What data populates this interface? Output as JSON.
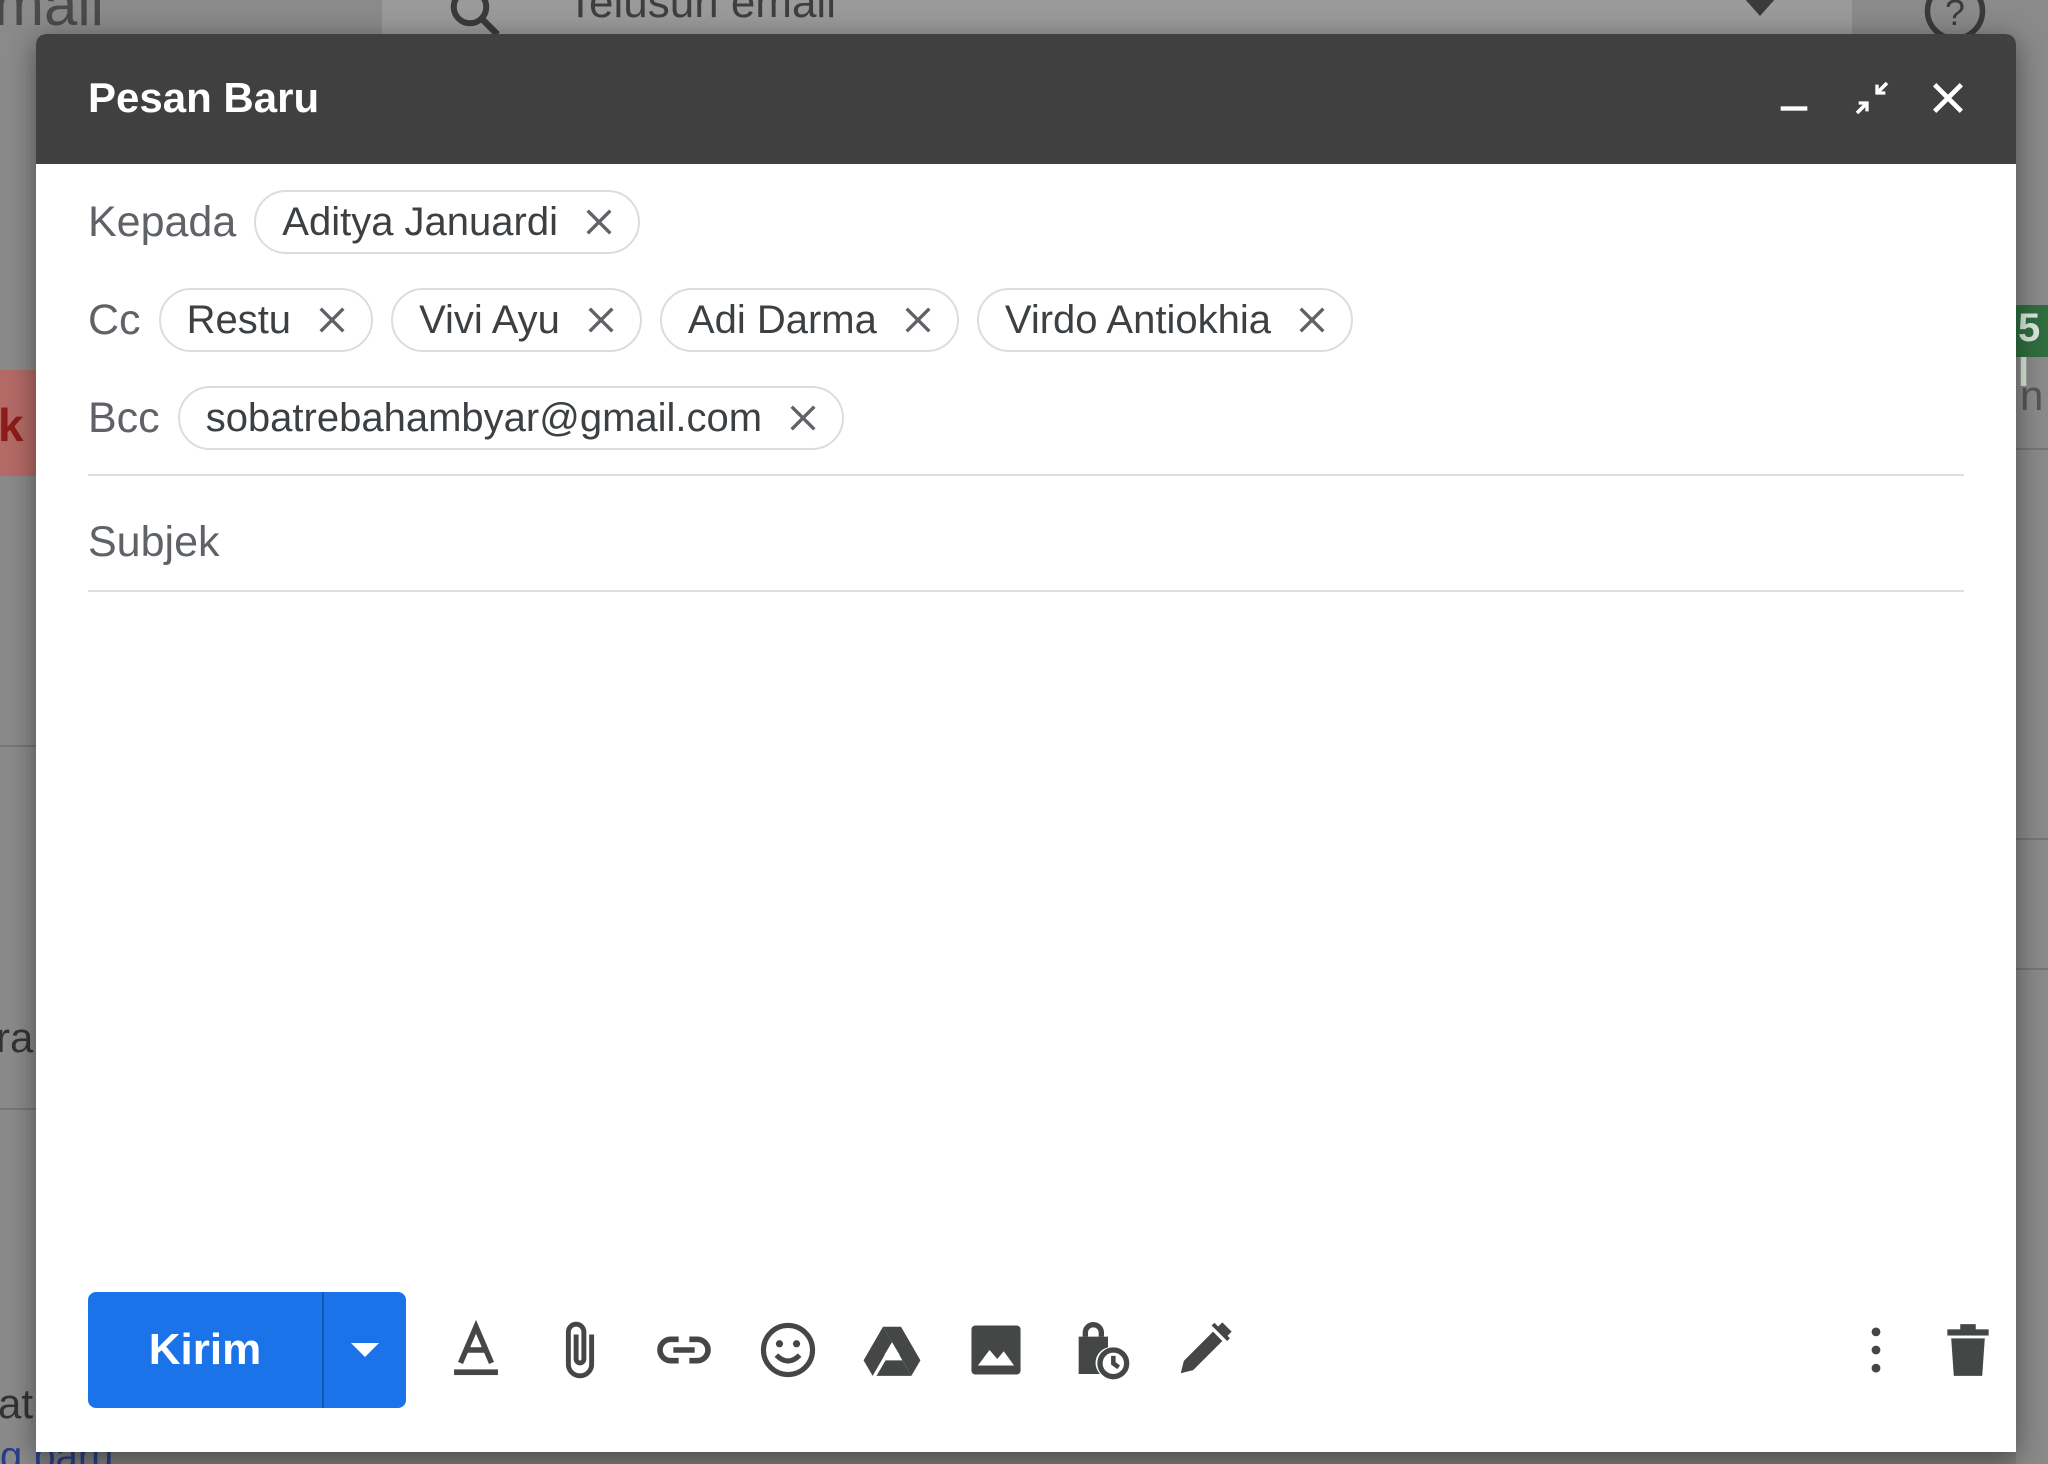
{
  "background": {
    "logo_text": "mail",
    "search_placeholder": "Telusuri email",
    "left_fragments": [
      "k",
      "ra",
      "at"
    ],
    "right_badge_text": "5 l",
    "right_fragment": "n",
    "bottom_link_fragment": "g baru"
  },
  "compose": {
    "title": "Pesan Baru",
    "to": {
      "label": "Kepada",
      "recipients": [
        "Aditya Januardi"
      ]
    },
    "cc": {
      "label": "Cc",
      "recipients": [
        "Restu",
        "Vivi Ayu",
        "Adi Darma",
        "Virdo Antiokhia"
      ]
    },
    "bcc": {
      "label": "Bcc",
      "recipients": [
        "sobatrebahambyar@gmail.com"
      ]
    },
    "subject": {
      "placeholder": "Subjek",
      "value": ""
    },
    "body": {
      "value": ""
    },
    "send_label": "Kirim",
    "toolbar_icons": [
      "formatting-icon",
      "attach-icon",
      "link-icon",
      "emoji-icon",
      "drive-icon",
      "photo-icon",
      "confidential-mode-icon",
      "signature-icon",
      "more-options-icon",
      "delete-icon"
    ],
    "colors": {
      "header": "#404040",
      "send": "#1a73e8",
      "chip_border": "#dadce0"
    }
  }
}
